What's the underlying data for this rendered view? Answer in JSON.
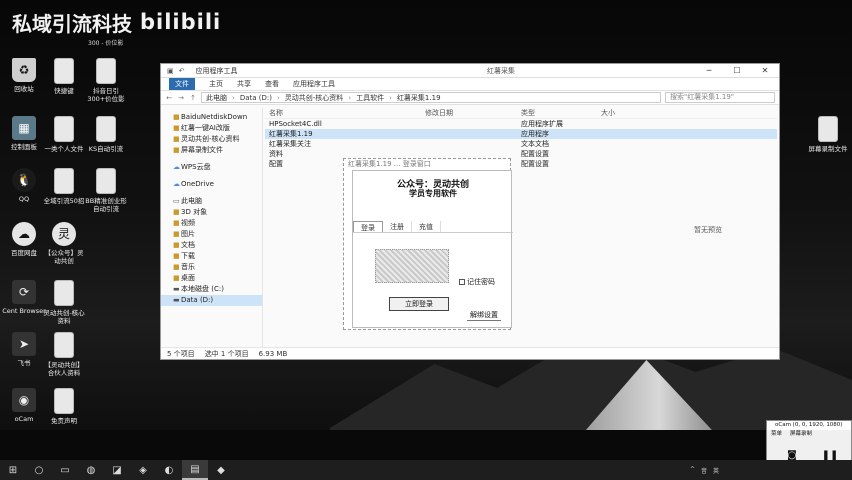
{
  "watermark": {
    "title": "私域引流科技",
    "logo": "bilibili",
    "sub": "300 - 价位影"
  },
  "desktop_icons": [
    {
      "label": "回收站",
      "icon": "recycle-bin"
    },
    {
      "label": "快捷键",
      "icon": "document"
    },
    {
      "label": "抖音日引300+价位影",
      "icon": "document"
    },
    {
      "label": "控制面板",
      "icon": "control-panel"
    },
    {
      "label": "一类个人文件",
      "icon": "document"
    },
    {
      "label": "KS自动引流",
      "icon": "document"
    },
    {
      "label": "QQ",
      "icon": "qq"
    },
    {
      "label": "全域引流50招",
      "icon": "document"
    },
    {
      "label": "BB精准创业形自动引流",
      "icon": "document"
    },
    {
      "label": "百度网盘",
      "icon": "cloud"
    },
    {
      "label": "【公众号】灵动共创",
      "icon": "logo"
    },
    {
      "label": "Cent Browser",
      "icon": "browser"
    },
    {
      "label": "灵动共创-核心资料",
      "icon": "document"
    },
    {
      "label": "飞书",
      "icon": "feishu"
    },
    {
      "label": "【灵动共创】合伙人资料",
      "icon": "document"
    },
    {
      "label": "oCam",
      "icon": "camera"
    },
    {
      "label": "免责声明",
      "icon": "document"
    },
    {
      "label": "屏幕录制文件",
      "icon": "document"
    }
  ],
  "explorer": {
    "title": "应用程序工具",
    "title_right": "红薯采集",
    "ribbon": [
      "文件",
      "主页",
      "共享",
      "查看",
      "应用程序工具"
    ],
    "path": [
      "此电脑",
      "Data (D:)",
      "灵动共创-核心资料",
      "工具软件",
      "红薯采集1.19"
    ],
    "search_placeholder": "搜索\"红薯采集1.19\"",
    "nav_items": [
      {
        "label": "BaiduNetdiskDown",
        "icon": "folder"
      },
      {
        "label": "红薯一键AI改版",
        "icon": "folder"
      },
      {
        "label": "灵动共创-核心资料",
        "icon": "folder"
      },
      {
        "label": "屏幕录制文件",
        "icon": "folder"
      },
      {
        "label": "WPS云盘",
        "icon": "cloud"
      },
      {
        "label": "OneDrive",
        "icon": "cloud"
      },
      {
        "label": "此电脑",
        "icon": "pc"
      },
      {
        "label": "3D 对象",
        "icon": "folder"
      },
      {
        "label": "视频",
        "icon": "folder"
      },
      {
        "label": "图片",
        "icon": "folder"
      },
      {
        "label": "文档",
        "icon": "folder"
      },
      {
        "label": "下载",
        "icon": "folder"
      },
      {
        "label": "音乐",
        "icon": "folder"
      },
      {
        "label": "桌面",
        "icon": "folder"
      },
      {
        "label": "本地磁盘 (C:)",
        "icon": "drive"
      },
      {
        "label": "Data (D:)",
        "icon": "drive"
      }
    ],
    "columns": [
      "名称",
      "修改日期",
      "类型",
      "大小"
    ],
    "files": [
      {
        "name": "HPSocket4C.dll",
        "date": "",
        "type": "应用程序扩展",
        "size": ""
      },
      {
        "name": "红薯采集1.19",
        "date": "",
        "type": "应用程序",
        "size": ""
      },
      {
        "name": "红薯采集关注",
        "date": "",
        "type": "文本文档",
        "size": ""
      },
      {
        "name": "资料",
        "date": "",
        "type": "配置设置",
        "size": ""
      },
      {
        "name": "配置",
        "date": "",
        "type": "配置设置",
        "size": ""
      }
    ],
    "status": [
      "5 个项目",
      "选中 1 个项目",
      "6.93 MB"
    ],
    "side_note": "暂无预览"
  },
  "login_dialog": {
    "header_line": "红薯采集1.19 ... 登录窗口",
    "title1": "公众号：灵动共创",
    "title2": "学员专用软件",
    "tabs": [
      "登录",
      "注册",
      "充值"
    ],
    "remember": "记住密码",
    "login_button": "立即登录",
    "unbind_button": "解绑设置"
  },
  "ocam": {
    "title": "oCam (0, 0, 1920, 1080)",
    "menu": [
      "菜单",
      "屏幕录制"
    ],
    "stop_label": "停止",
    "pause_label": "停止"
  },
  "taskbar": {
    "items": [
      "windows",
      "search",
      "task-view",
      "browser",
      "app",
      "app",
      "app",
      "explorer",
      "app"
    ],
    "tray": [
      "^",
      "音",
      "英"
    ]
  }
}
